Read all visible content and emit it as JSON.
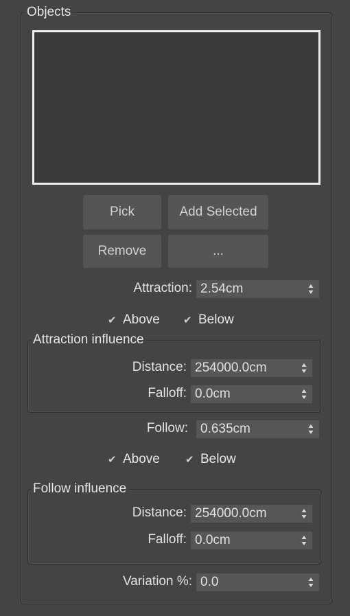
{
  "objects_group": {
    "title": "Objects"
  },
  "buttons": {
    "pick": "Pick",
    "add_selected": "Add Selected",
    "remove": "Remove",
    "more": "..."
  },
  "attraction": {
    "label": "Attraction:",
    "value": "2.54cm"
  },
  "attraction_checks": {
    "above": "Above",
    "below": "Below",
    "above_checked": true,
    "below_checked": true
  },
  "attraction_influence": {
    "title": "Attraction influence",
    "distance_label": "Distance:",
    "distance_value": "254000.0cm",
    "falloff_label": "Falloff:",
    "falloff_value": "0.0cm"
  },
  "follow": {
    "label": "Follow:",
    "value": "0.635cm"
  },
  "follow_checks": {
    "above": "Above",
    "below": "Below",
    "above_checked": true,
    "below_checked": true
  },
  "follow_influence": {
    "title": "Follow influence",
    "distance_label": "Distance:",
    "distance_value": "254000.0cm",
    "falloff_label": "Falloff:",
    "falloff_value": "0.0cm"
  },
  "variation": {
    "label": "Variation %:",
    "value": "0.0"
  }
}
